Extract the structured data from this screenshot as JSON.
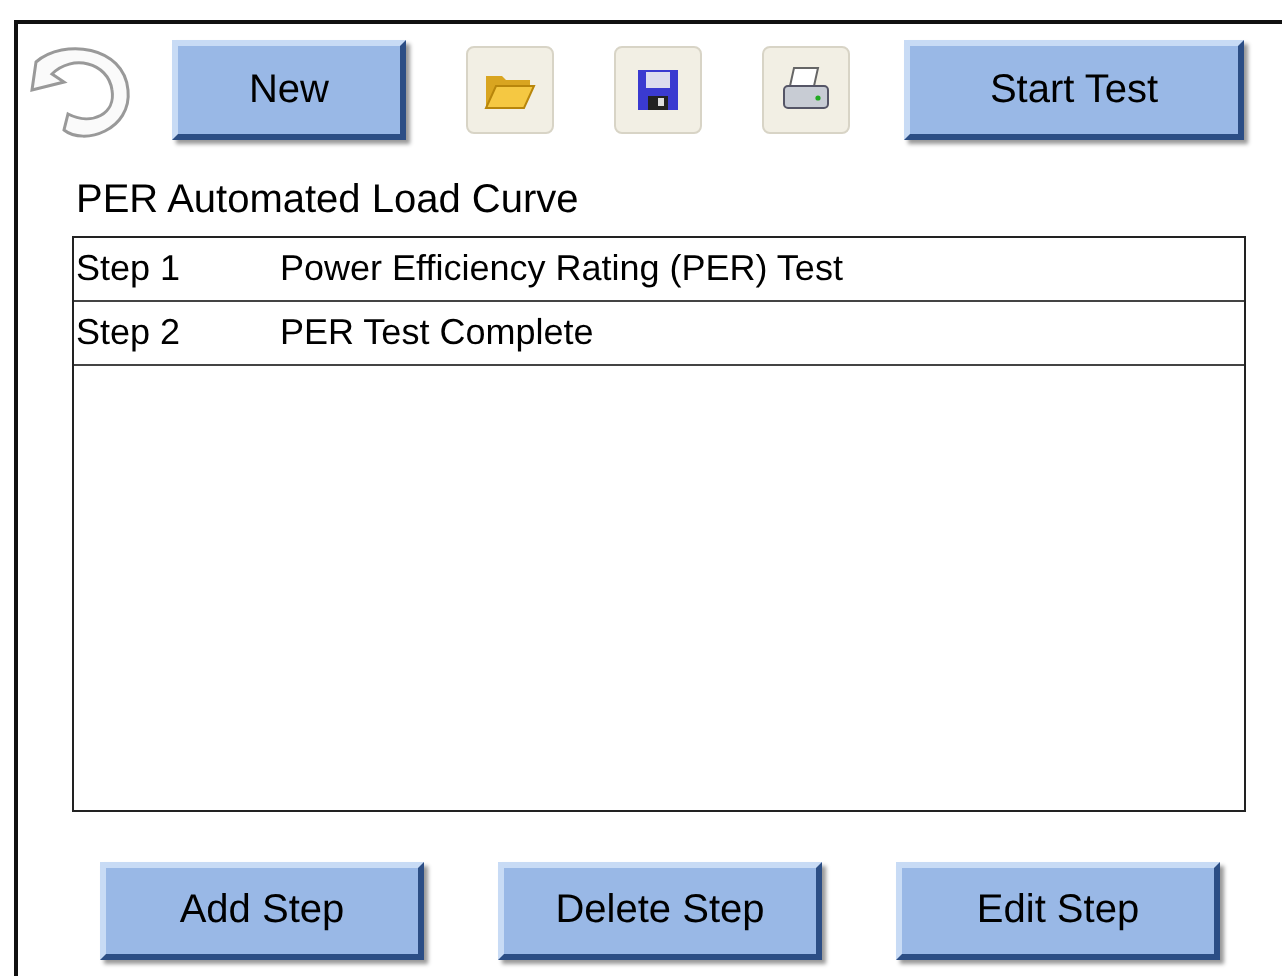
{
  "toolbar": {
    "buttons": [
      {
        "kind": "back"
      },
      {
        "kind": "text",
        "label": "New"
      },
      {
        "kind": "open"
      },
      {
        "kind": "save"
      },
      {
        "kind": "print"
      },
      {
        "kind": "text",
        "label": "Start Test"
      }
    ]
  },
  "title": "PER Automated Load Curve",
  "steps": [
    {
      "step": "Step 1",
      "description": "Power Efficiency Rating (PER) Test"
    },
    {
      "step": "Step 2",
      "description": "PER Test Complete"
    }
  ],
  "buttons": [
    "Add Step",
    "Delete Step",
    "Edit Step"
  ]
}
